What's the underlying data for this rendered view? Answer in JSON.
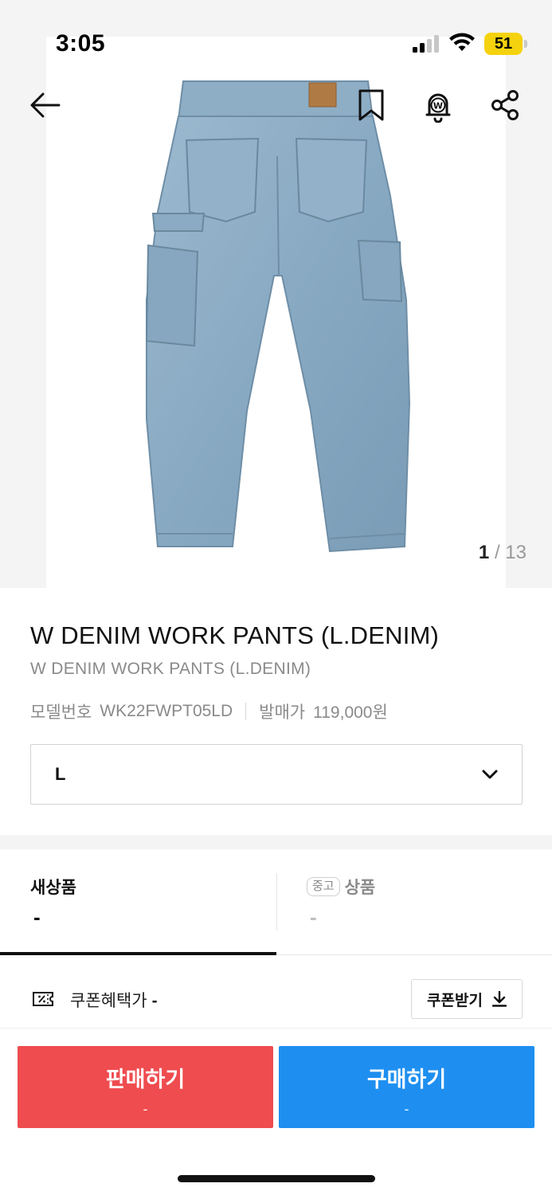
{
  "status_bar": {
    "time": "3:05",
    "battery": "51"
  },
  "nav": {
    "back_icon": "arrow-left-icon",
    "bookmark_icon": "bookmark-icon",
    "alert_icon": "bell-w-icon",
    "share_icon": "share-icon"
  },
  "gallery": {
    "current": "1",
    "separator": " / ",
    "total": "13"
  },
  "product": {
    "title": "W DENIM WORK PANTS (L.DENIM)",
    "subtitle": "W DENIM WORK PANTS (L.DENIM)",
    "model_label": "모델번호",
    "model_value": "WK22FWPT05LD",
    "release_label": "발매가",
    "release_value": "119,000원"
  },
  "size_select": {
    "value": "L",
    "icon": "chevron-down-icon"
  },
  "tabs": {
    "new": {
      "label": "새상품",
      "price": "-"
    },
    "used": {
      "badge": "중고",
      "label": "상품",
      "price": "-"
    }
  },
  "coupon": {
    "label": "쿠폰혜택가",
    "value": "-",
    "button": "쿠폰받기",
    "icon": "coupon-icon"
  },
  "actions": {
    "sell": {
      "label": "판매하기",
      "price": "-",
      "color": "#ef4c4f"
    },
    "buy": {
      "label": "구매하기",
      "price": "-",
      "color": "#1e8ff0"
    }
  }
}
